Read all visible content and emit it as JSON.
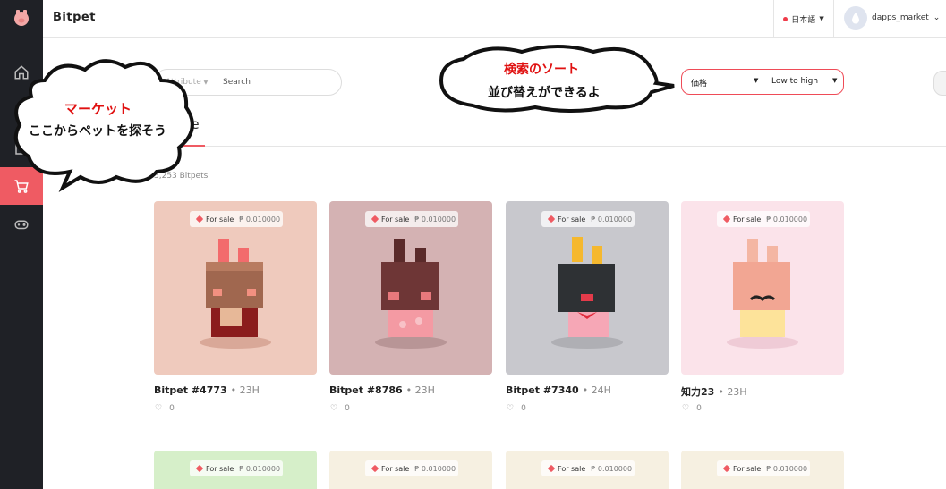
{
  "app": {
    "title": "Bitpet"
  },
  "header": {
    "language": "日本語",
    "username": "dapps_market"
  },
  "filter": {
    "attribute_label": "Attribute",
    "search_placeholder": "Search"
  },
  "sort": {
    "field": "価格",
    "order": "Low to high"
  },
  "tab": {
    "title_partial": "ale"
  },
  "listing": {
    "count": "5,253 Bitpets"
  },
  "cards": [
    {
      "status": "For sale",
      "price": "₱ 0.010000",
      "name": "Bitpet #4773",
      "age": "23H",
      "likes": "0",
      "bg": "#efcabd"
    },
    {
      "status": "For sale",
      "price": "₱ 0.010000",
      "name": "Bitpet #8786",
      "age": "23H",
      "likes": "0",
      "bg": "#d4b2b3"
    },
    {
      "status": "For sale",
      "price": "₱ 0.010000",
      "name": "Bitpet #7340",
      "age": "24H",
      "likes": "0",
      "bg": "#c8c8cd"
    },
    {
      "status": "For sale",
      "price": "₱ 0.010000",
      "name": "知力23",
      "age": "23H",
      "likes": "0",
      "bg": "#fbe3ea"
    },
    {
      "status": "For sale",
      "price": "₱ 0.010000",
      "bg": "#d6efc9"
    },
    {
      "status": "For sale",
      "price": "₱ 0.010000",
      "bg": "#f6f0e1"
    },
    {
      "status": "For sale",
      "price": "₱ 0.010000",
      "bg": "#f6f0e1"
    },
    {
      "status": "For sale",
      "price": "₱ 0.010000",
      "bg": "#f6f0e1"
    }
  ],
  "annotations": {
    "market_title": "マーケット",
    "market_body": "ここからペットを探そう",
    "sort_title": "検索のソート",
    "sort_body": "並び替えができるよ"
  },
  "colors": {
    "accent": "#ef5b63",
    "sidebar": "#1f2126",
    "annotation_red": "#e01010"
  },
  "icons": [
    "pig-logo-icon",
    "home-icon",
    "pets-icon",
    "shop-icon",
    "cart-icon",
    "gamepad-icon",
    "globe-dot-icon",
    "chevron-down-icon",
    "tag-icon",
    "heart-icon"
  ]
}
